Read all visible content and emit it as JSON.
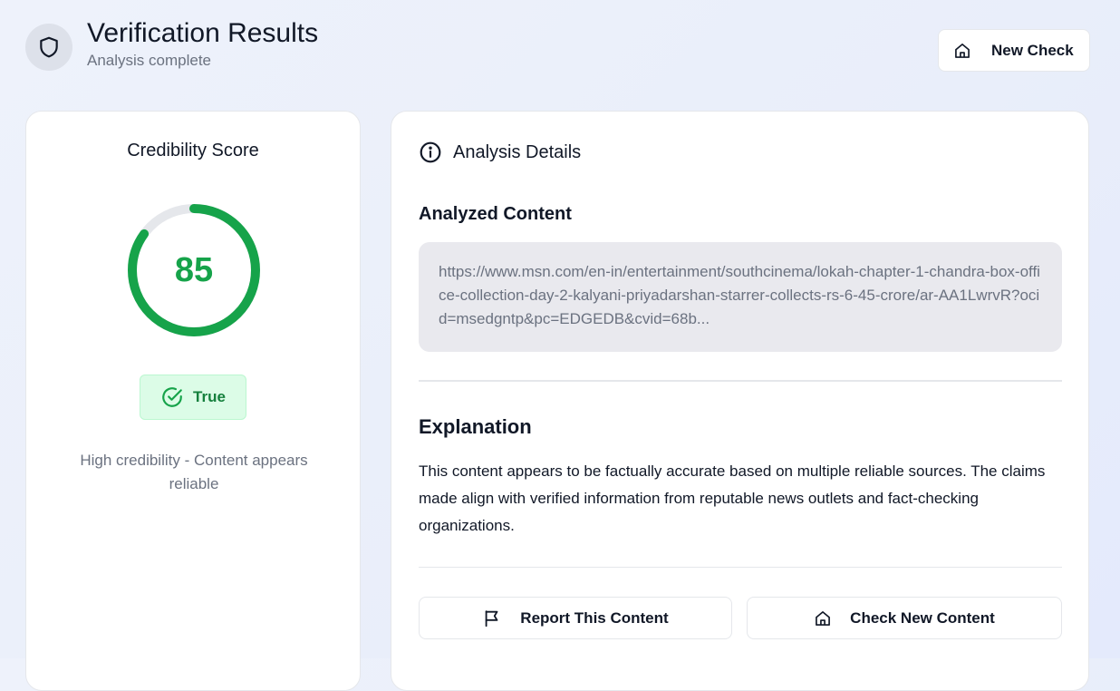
{
  "header": {
    "icon": "shield-icon",
    "title": "Verification Results",
    "subtitle": "Analysis complete",
    "new_check_icon": "home-icon",
    "new_check_label": "New Check"
  },
  "score_card": {
    "title": "Credibility Score",
    "score": "85",
    "score_fraction": 0.85,
    "score_color": "#16a34a",
    "verdict_icon": "check-circle-icon",
    "verdict_label": "True",
    "description": "High credibility - Content appears reliable"
  },
  "details": {
    "header_icon": "info-icon",
    "header_label": "Analysis Details",
    "analyzed_heading": "Analyzed Content",
    "analyzed_content": "https://www.msn.com/en-in/entertainment/southcinema/lokah-chapter-1-chandra-box-office-collection-day-2-kalyani-priyadarshan-starrer-collects-rs-6-45-crore/ar-AA1LwrvR?ocid=msedgntp&pc=EDGEDB&cvid=68b...",
    "explanation_heading": "Explanation",
    "explanation_text": "This content appears to be factually accurate based on multiple reliable sources. The claims made align with verified information from reputable news outlets and fact-checking organizations."
  },
  "actions": {
    "report_icon": "flag-icon",
    "report_label": "Report This Content",
    "check_new_icon": "home-icon",
    "check_new_label": "Check New Content"
  }
}
